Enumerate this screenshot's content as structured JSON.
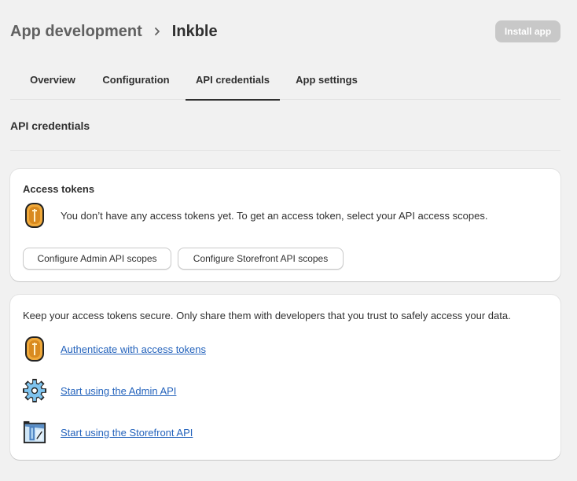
{
  "breadcrumb": {
    "parent": "App development",
    "separator_icon": "chevron-right-icon",
    "current": "Inkble"
  },
  "header": {
    "install_label": "Install app",
    "install_state": "disabled"
  },
  "tabs": [
    {
      "label": "Overview",
      "active": false
    },
    {
      "label": "Configuration",
      "active": false
    },
    {
      "label": "API credentials",
      "active": true
    },
    {
      "label": "App settings",
      "active": false
    }
  ],
  "section": {
    "title": "API credentials"
  },
  "access_tokens": {
    "title": "Access tokens",
    "icon": "coin-icon",
    "message": "You don’t have any access tokens yet. To get an access token, select your API access scopes.",
    "buttons": {
      "admin_scopes": "Configure Admin API scopes",
      "storefront_scopes": "Configure Storefront API scopes"
    }
  },
  "security": {
    "note": "Keep your access tokens secure. Only share them with developers that you trust to safely access your data.",
    "links": [
      {
        "label": "Authenticate with access tokens",
        "icon": "coin-icon"
      },
      {
        "label": "Start using the Admin API",
        "icon": "gear-icon"
      },
      {
        "label": "Start using the Storefront API",
        "icon": "storefront-icon"
      }
    ]
  },
  "colors": {
    "background": "#f1f1f1",
    "link": "#2463bc",
    "disabled_button": "#c8c8c8",
    "coin": "#f0a93a",
    "gear": "#7fc4ef"
  }
}
